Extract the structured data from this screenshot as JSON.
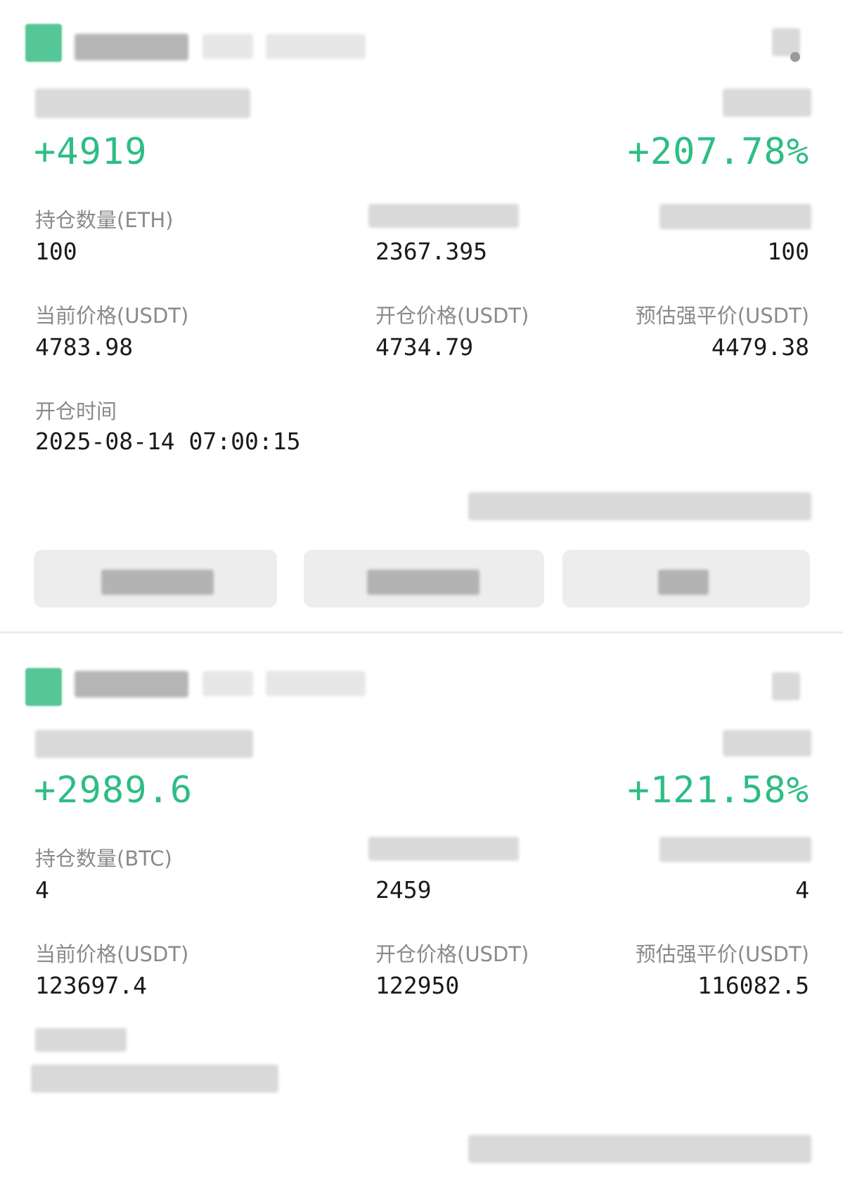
{
  "colors": {
    "profit_green": "#2ebd85",
    "label_gray": "#8a8a8a",
    "button_bg": "#ededee"
  },
  "positions": [
    {
      "pnl": "+4919",
      "pnl_pct": "+207.78%",
      "qty_label": "持仓数量(ETH)",
      "qty_value": "100",
      "margin_value": "2367.395",
      "col3_value": "100",
      "current_price_label": "当前价格(USDT)",
      "current_price": "4783.98",
      "open_price_label": "开仓价格(USDT)",
      "open_price": "4734.79",
      "liq_price_label": "预估强平价(USDT)",
      "liq_price": "4479.38",
      "open_time_label": "开仓时间",
      "open_time": "2025-08-14 07:00:15"
    },
    {
      "pnl": "+2989.6",
      "pnl_pct": "+121.58%",
      "qty_label": "持仓数量(BTC)",
      "qty_value": "4",
      "margin_value": "2459",
      "col3_value": "4",
      "current_price_label": "当前价格(USDT)",
      "current_price": "123697.4",
      "open_price_label": "开仓价格(USDT)",
      "open_price": "122950",
      "liq_price_label": "预估强平价(USDT)",
      "liq_price": "116082.5"
    }
  ]
}
